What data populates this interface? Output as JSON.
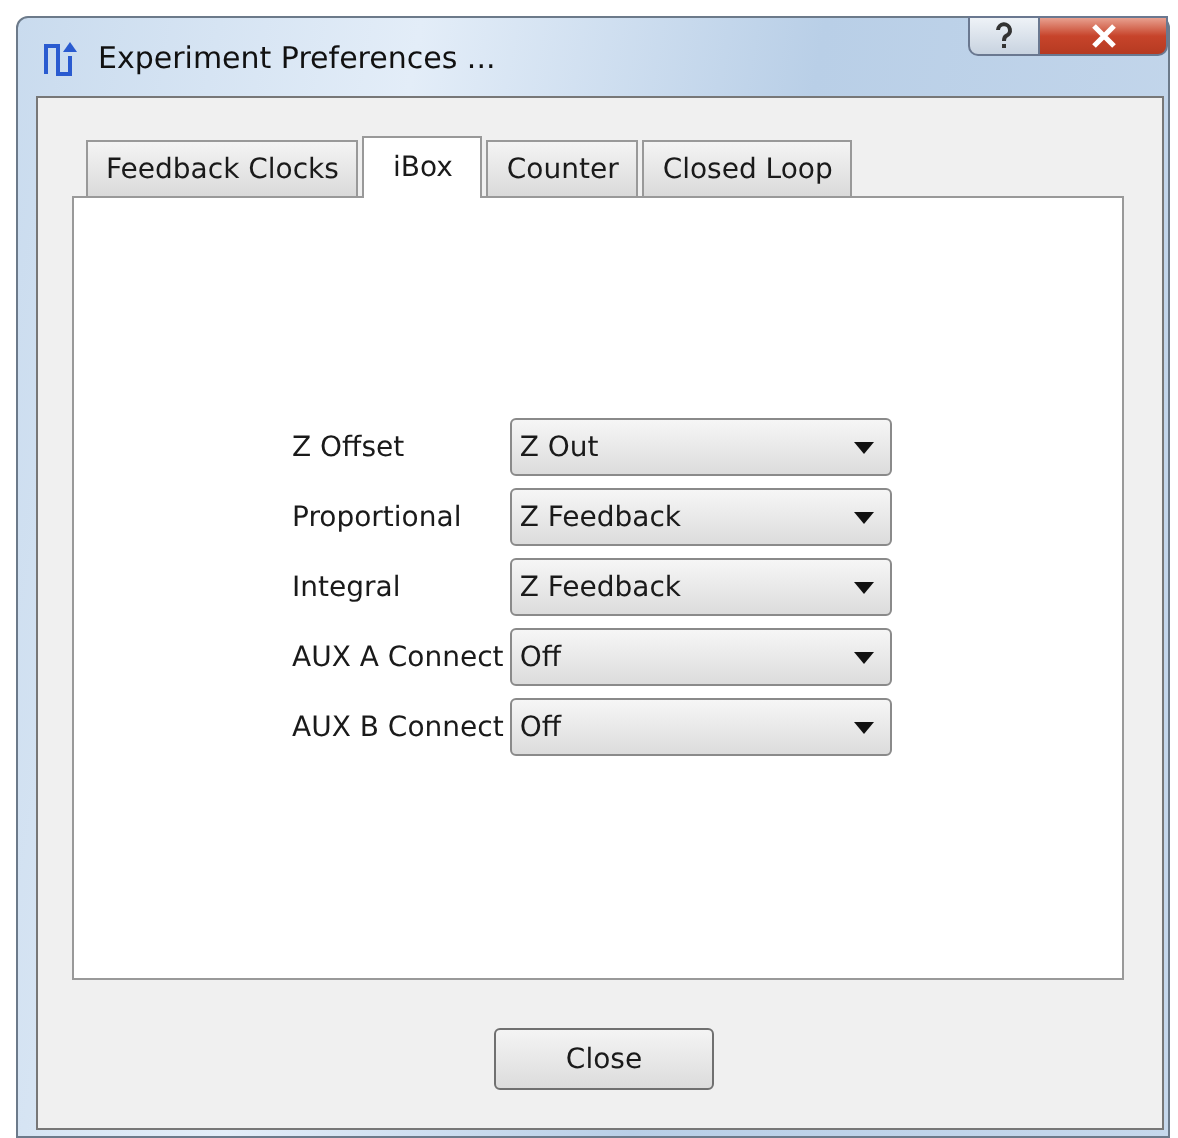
{
  "window": {
    "title": "Experiment Preferences ..."
  },
  "tabs": [
    {
      "label": "Feedback Clocks",
      "selected": false
    },
    {
      "label": "iBox",
      "selected": true
    },
    {
      "label": "Counter",
      "selected": false
    },
    {
      "label": "Closed Loop",
      "selected": false
    }
  ],
  "fields": [
    {
      "label": "Z Offset",
      "value": "Z Out"
    },
    {
      "label": "Proportional",
      "value": "Z Feedback"
    },
    {
      "label": "Integral",
      "value": "Z Feedback"
    },
    {
      "label": "AUX A Connect",
      "value": "Off"
    },
    {
      "label": "AUX B Connect",
      "value": "Off"
    }
  ],
  "buttons": [
    "Close"
  ]
}
